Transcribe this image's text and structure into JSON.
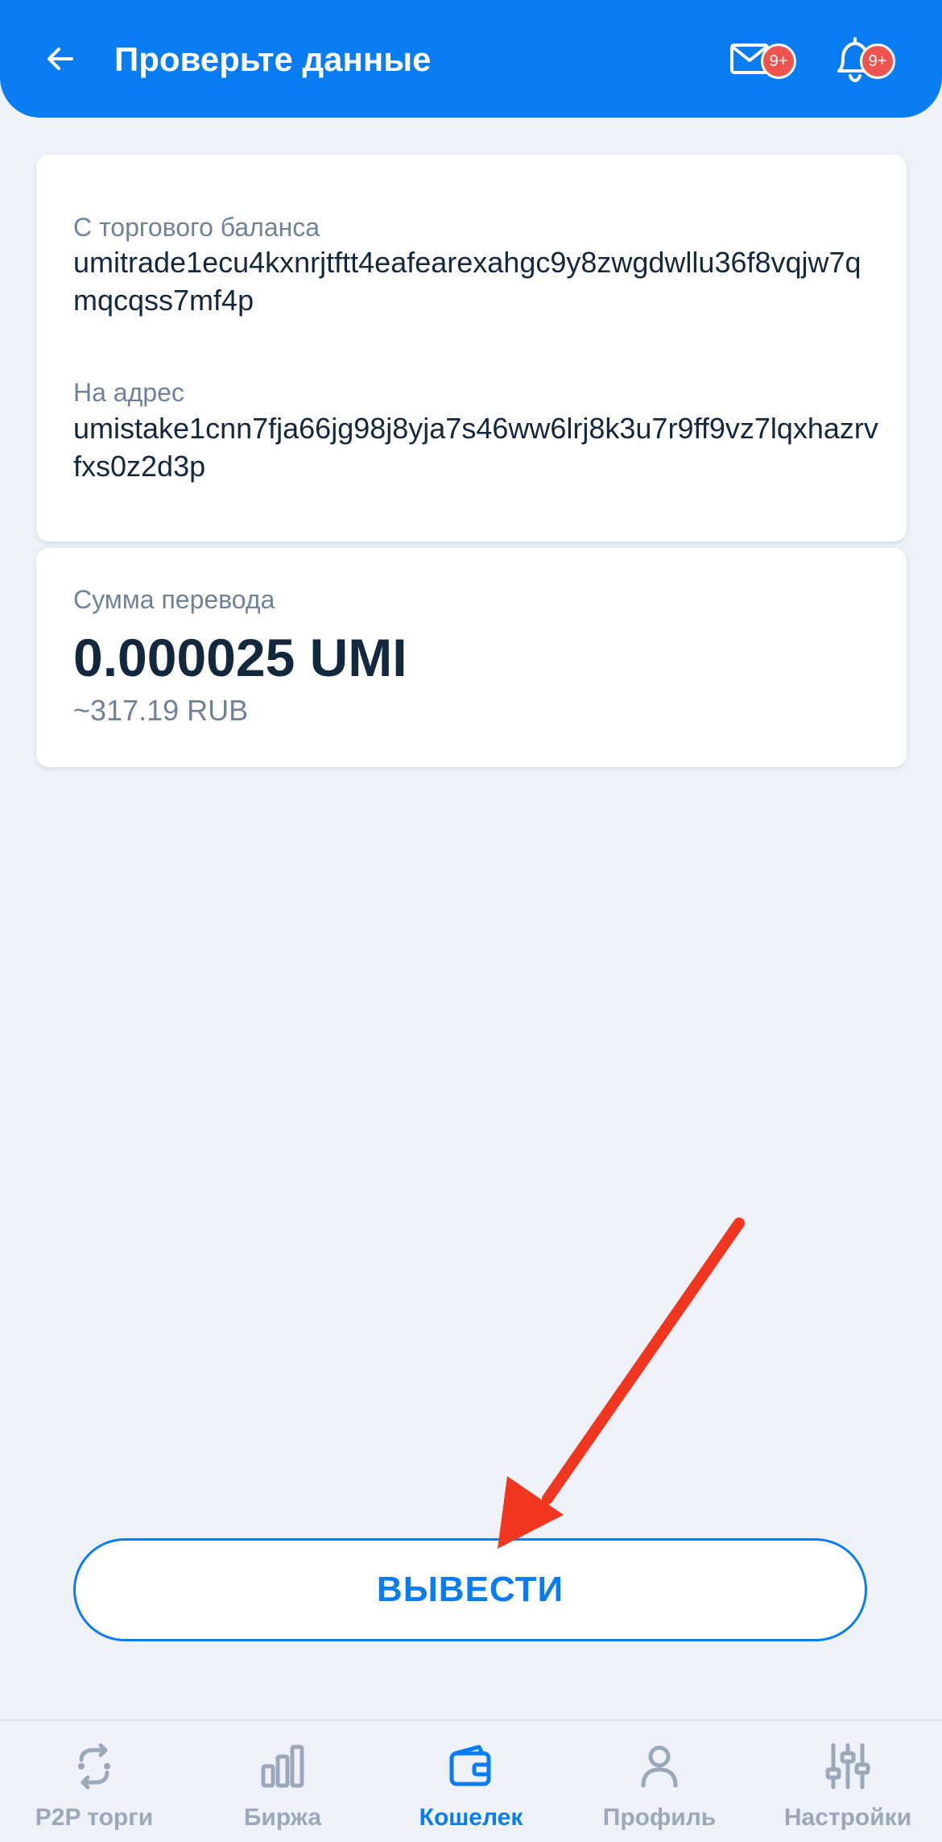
{
  "header": {
    "title": "Проверьте данные",
    "mail_badge": "9+",
    "bell_badge": "9+"
  },
  "transfer": {
    "from_label": "С торгового баланса",
    "from_address": "umitrade1ecu4kxnrjtftt4eafearexahgc9y8zwgdwllu36f8vqjw7qmqcqss7mf4p",
    "to_label": "На адрес",
    "to_address": "umistake1cnn7fja66jg98j8yja7s46ww6lrj8k3u7r9ff9vz7lqxhazrvfxs0z2d3p",
    "amount_label": "Сумма перевода",
    "amount": "0.000025 UMI",
    "amount_fiat": "~317.19 RUB"
  },
  "actions": {
    "withdraw_label": "ВЫВЕСТИ"
  },
  "bottom_nav": {
    "items": [
      {
        "label": "P2P торги",
        "icon": "p2p-exchange-icon",
        "active": false
      },
      {
        "label": "Биржа",
        "icon": "bar-chart-icon",
        "active": false
      },
      {
        "label": "Кошелек",
        "icon": "wallet-icon",
        "active": true
      },
      {
        "label": "Профиль",
        "icon": "user-icon",
        "active": false
      },
      {
        "label": "Настройки",
        "icon": "sliders-icon",
        "active": false
      }
    ]
  },
  "colors": {
    "primary": "#0a7cf2",
    "background": "#eef1f7",
    "text": "#14283d",
    "muted": "#6f8297",
    "badge": "#ef5350",
    "annotation_arrow": "#f0361f"
  }
}
